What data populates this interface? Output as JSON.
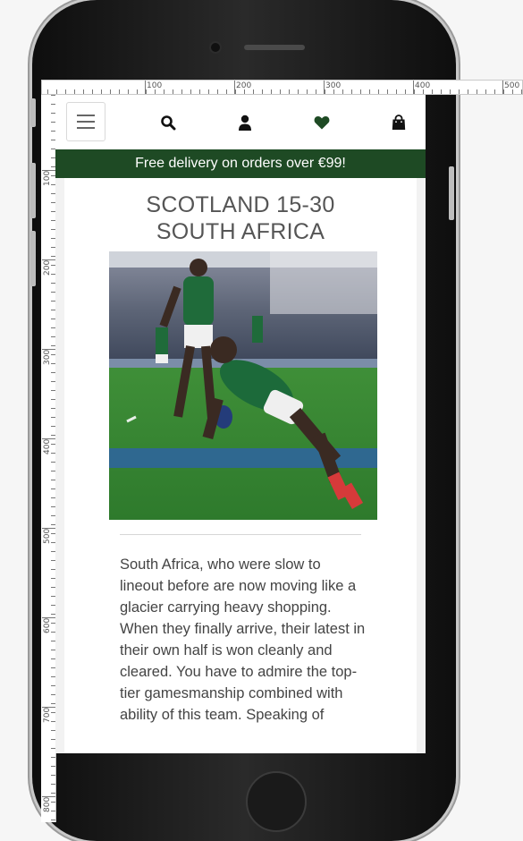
{
  "ruler": {
    "top_labels": [
      "100",
      "200",
      "300",
      "400",
      "500"
    ],
    "left_labels": [
      "100",
      "200",
      "300",
      "400",
      "500",
      "600",
      "700",
      "800"
    ]
  },
  "navbar": {
    "menu_icon": "hamburger-menu-icon",
    "search_icon": "search-icon",
    "account_icon": "user-icon",
    "wishlist_icon": "heart-icon",
    "bag_icon": "shopping-bag-icon"
  },
  "promo": {
    "text": "Free delivery on orders over €99!"
  },
  "article": {
    "title_line1": "SCOTLAND 15-30",
    "title_line2": "SOUTH AFRICA",
    "body": "South Africa, who were slow to lineout before are now moving like a glacier carrying heavy shopping. When they finally arrive, their latest in their own half is won cleanly and cleared. You have to admire the top-tier gamesmanship combined with ability of this team. Speaking of"
  },
  "colors": {
    "brand_green": "#1e4a24",
    "heart_green": "#1e4a24"
  }
}
